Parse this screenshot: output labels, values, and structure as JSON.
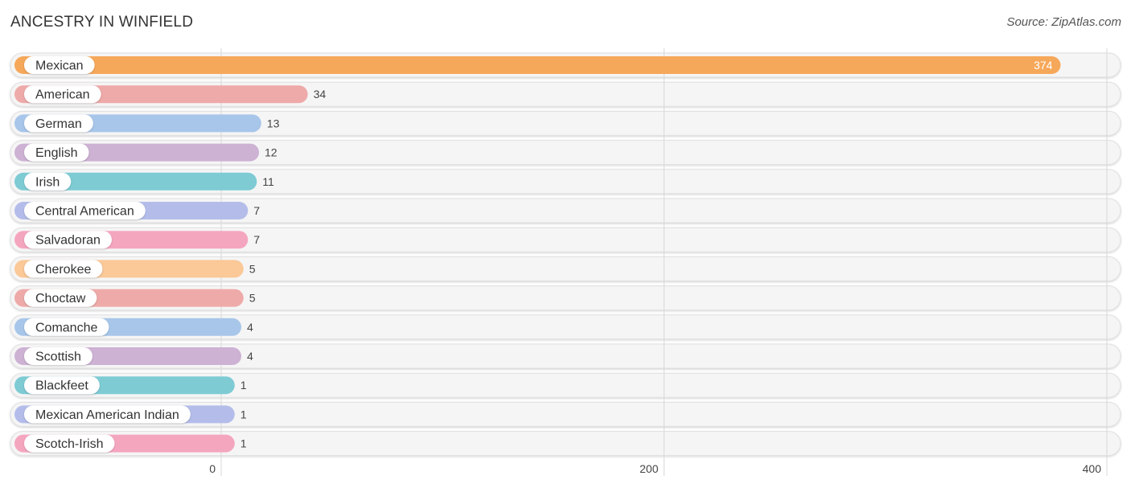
{
  "header": {
    "title": "ANCESTRY IN WINFIELD",
    "source": "Source: ZipAtlas.com"
  },
  "chart_data": {
    "type": "bar",
    "orientation": "horizontal",
    "title": "ANCESTRY IN WINFIELD",
    "xlabel": "",
    "ylabel": "",
    "xlim": [
      0,
      400
    ],
    "xticks": [
      0,
      200,
      400
    ],
    "xtick_labels": [
      "0",
      "200",
      "400"
    ],
    "grid": true,
    "categories": [
      "Mexican",
      "American",
      "German",
      "English",
      "Irish",
      "Central American",
      "Salvadoran",
      "Cherokee",
      "Choctaw",
      "Comanche",
      "Scottish",
      "Blackfeet",
      "Mexican American Indian",
      "Scotch-Irish"
    ],
    "values": [
      374,
      34,
      13,
      12,
      11,
      7,
      7,
      5,
      5,
      4,
      4,
      1,
      1,
      1
    ],
    "value_labels": [
      "374",
      "34",
      "13",
      "12",
      "11",
      "7",
      "7",
      "5",
      "5",
      "4",
      "4",
      "1",
      "1",
      "1"
    ],
    "colors": [
      "#f6a85a",
      "#eeaaa9",
      "#a8c6ea",
      "#cdb2d4",
      "#7ecbd4",
      "#b4bdea",
      "#f5a6bf",
      "#fbc898",
      "#eeaaa9",
      "#a8c6ea",
      "#cdb2d4",
      "#7ecbd4",
      "#b4bdea",
      "#f5a6bf"
    ]
  }
}
